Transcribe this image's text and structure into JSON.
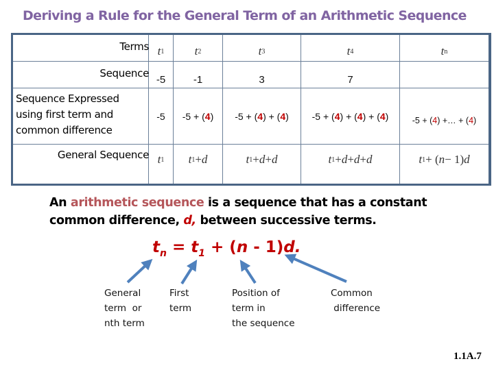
{
  "title": "Deriving a Rule for the General Term of an Arithmetic Sequence",
  "table": {
    "row_labels": {
      "terms": "Terms",
      "sequence": "Sequence",
      "expressed_line1": "Sequence Expressed",
      "expressed_line2": "using first term and",
      "expressed_line3": "common difference",
      "general": "General Sequence"
    },
    "terms": [
      {
        "base": "t",
        "sub": "1"
      },
      {
        "base": "t",
        "sub": "2"
      },
      {
        "base": "t",
        "sub": "3"
      },
      {
        "base": "t",
        "sub": "4"
      },
      {
        "base": "t",
        "sub": "n"
      }
    ],
    "sequence": [
      "-5",
      "-1",
      "3",
      "7",
      ""
    ],
    "expressed": {
      "c1": "-5",
      "c2_pre": "-5 + (",
      "c2_d": "4",
      "c2_post": ")",
      "c3_pre": "-5 + (",
      "c3_d1": "4",
      "c3_mid": ") + (",
      "c3_d2": "4",
      "c3_post": ")",
      "c4_pre": "-5 + (",
      "c4_d1": "4",
      "c4_mid1": ") + (",
      "c4_d2": "4",
      "c4_mid2": ") + (",
      "c4_d3": "4",
      "c4_post": ")",
      "c5_pre": "-5 + (",
      "c5_d1": "4",
      "c5_mid": ") +… + (",
      "c5_d2": "4",
      "c5_post": ")"
    },
    "general": {
      "t": "t",
      "one": "1",
      "d": "d",
      "plus": " + ",
      "n_part_open": " + (",
      "n": "n",
      "minus_one": " − 1)"
    }
  },
  "definition": {
    "line1_pre": "An ",
    "highlight": "arithmetic sequence",
    "line1_post": " is a sequence that has a constant",
    "line2_pre": "common difference, ",
    "d_symbol": "d,",
    "line2_post": " between successive terms."
  },
  "formula": {
    "t": "t",
    "n_sub": "n",
    "eq": " = ",
    "one_sub": "1",
    "plus": " + (",
    "n": "n",
    "minus": " - 1)",
    "d": "d."
  },
  "labels": {
    "general_term": [
      "General",
      "term  or",
      "nth term"
    ],
    "first_term": [
      "First",
      "term"
    ],
    "position": [
      "Position of",
      "term in",
      "the sequence"
    ],
    "common_difference": [
      "Common",
      " difference"
    ]
  },
  "slide_number": "1.1A.7",
  "colors": {
    "title": "#8064a2",
    "table_border": "#4a6585",
    "accent_red": "#c00000",
    "highlight": "#b5565a",
    "arrow": "#4f81bd"
  }
}
